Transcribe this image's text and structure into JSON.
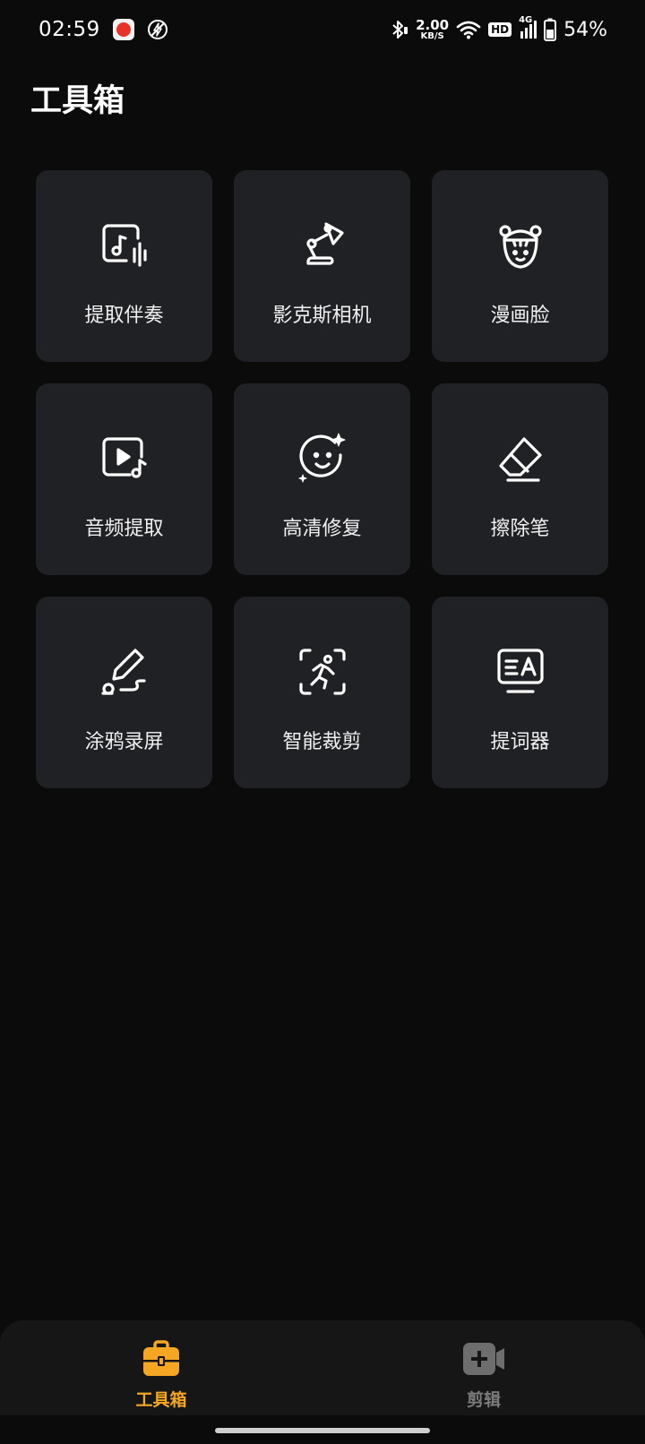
{
  "status_bar": {
    "time": "02:59",
    "net_speed_value": "2.00",
    "net_speed_unit": "KB/S",
    "hd_label": "HD",
    "network_type": "4G",
    "battery_percent": "54%"
  },
  "page_title": "工具箱",
  "tools": [
    {
      "label": "提取伴奏",
      "icon": "music-extract-icon"
    },
    {
      "label": "影克斯相机",
      "icon": "desk-lamp-icon"
    },
    {
      "label": "漫画脸",
      "icon": "cartoon-face-icon"
    },
    {
      "label": "音频提取",
      "icon": "video-audio-icon"
    },
    {
      "label": "高清修复",
      "icon": "sparkle-face-icon"
    },
    {
      "label": "擦除笔",
      "icon": "eraser-icon"
    },
    {
      "label": "涂鸦录屏",
      "icon": "doodle-pen-icon"
    },
    {
      "label": "智能裁剪",
      "icon": "smart-crop-icon"
    },
    {
      "label": "提词器",
      "icon": "teleprompter-icon"
    }
  ],
  "bottom_nav": {
    "items": [
      {
        "label": "工具箱",
        "icon": "toolbox-icon",
        "active": true
      },
      {
        "label": "剪辑",
        "icon": "video-add-icon",
        "active": false
      }
    ]
  },
  "colors": {
    "background": "#0b0b0b",
    "card": "#202124",
    "accent": "#f5a623",
    "nav_inactive": "#7b7b7b"
  }
}
